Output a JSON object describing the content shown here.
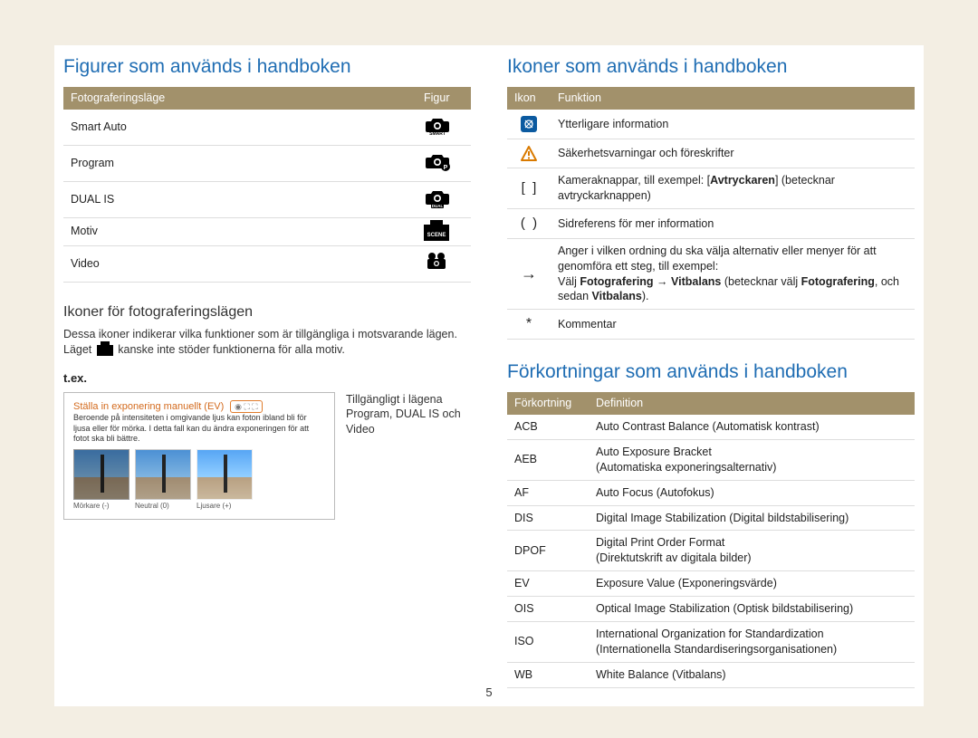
{
  "left": {
    "title": "Figurer som används i handboken",
    "table": {
      "headers": {
        "col1": "Fotograferingsläge",
        "col2": "Figur"
      },
      "rows": [
        {
          "mode": "Smart Auto",
          "icon": "camera-smart-icon"
        },
        {
          "mode": "Program",
          "icon": "camera-p-icon"
        },
        {
          "mode": "DUAL IS",
          "icon": "camera-dual-icon"
        },
        {
          "mode": "Motiv",
          "icon": "camera-scene-icon"
        },
        {
          "mode": "Video",
          "icon": "camera-video-icon"
        }
      ]
    },
    "subTitle": "Ikoner för fotograferingslägen",
    "bodyTextPre": "Dessa ikoner indikerar vilka funktioner som är tillgängliga i motsvarande lägen. Läget ",
    "bodyTextPost": " kanske inte stöder funktionerna för alla motiv.",
    "exampleLabel": "t.ex.",
    "example": {
      "panelTitle": "Ställa in exponering manuellt (EV)",
      "panelIcons": "◉ ⛶ ⛶",
      "panelDesc": "Beroende på intensiteten i omgivande ljus kan foton ibland bli för ljusa eller för mörka. I detta fall kan du ändra exponeringen för att fotot ska bli bättre.",
      "thumbs": [
        {
          "label": "Mörkare (-)",
          "variant": "dark"
        },
        {
          "label": "Neutral (0)",
          "variant": ""
        },
        {
          "label": "Ljusare (+)",
          "variant": "light"
        }
      ],
      "caption": "Tillgängligt i lägena Program, DUAL IS och Video"
    }
  },
  "rightTop": {
    "title": "Ikoner som används i handboken",
    "headers": {
      "col1": "Ikon",
      "col2": "Funktion"
    },
    "rows": [
      {
        "icon": "info-square-icon",
        "text": "Ytterligare information"
      },
      {
        "icon": "warning-triangle-icon",
        "text": "Säkerhetsvarningar och föreskrifter"
      },
      {
        "icon": "brackets-icon",
        "textHtml": "Kameraknappar, till exempel: [<b>Avtryckaren</b>] (betecknar avtryckarknappen)"
      },
      {
        "icon": "parens-icon",
        "text": "Sidreferens för mer information"
      },
      {
        "icon": "arrow-right-icon",
        "textHtml": "Anger i vilken ordning du ska välja alternativ eller menyer för att genomföra ett steg, till exempel:<br>Välj <b>Fotografering</b> → <b>Vitbalans</b> (betecknar välj <b>Fotografering</b>, och sedan <b>Vitbalans</b>)."
      },
      {
        "icon": "asterisk-icon",
        "text": "Kommentar"
      }
    ]
  },
  "rightBottom": {
    "title": "Förkortningar som används i handboken",
    "headers": {
      "col1": "Förkortning",
      "col2": "Definition"
    },
    "rows": [
      {
        "abbr": "ACB",
        "def": "Auto Contrast Balance (Automatisk kontrast)"
      },
      {
        "abbr": "AEB",
        "def": "Auto Exposure Bracket\n(Automatiska exponeringsalternativ)"
      },
      {
        "abbr": "AF",
        "def": "Auto Focus (Autofokus)"
      },
      {
        "abbr": "DIS",
        "def": "Digital Image Stabilization (Digital bildstabilisering)"
      },
      {
        "abbr": "DPOF",
        "def": "Digital Print Order Format\n(Direktutskrift av digitala bilder)"
      },
      {
        "abbr": "EV",
        "def": "Exposure Value (Exponeringsvärde)"
      },
      {
        "abbr": "OIS",
        "def": "Optical Image Stabilization (Optisk bildstabilisering)"
      },
      {
        "abbr": "ISO",
        "def": "International Organization for Standardization\n(Internationella Standardiseringsorganisationen)"
      },
      {
        "abbr": "WB",
        "def": "White Balance (Vitbalans)"
      }
    ]
  },
  "pageNumber": "5"
}
